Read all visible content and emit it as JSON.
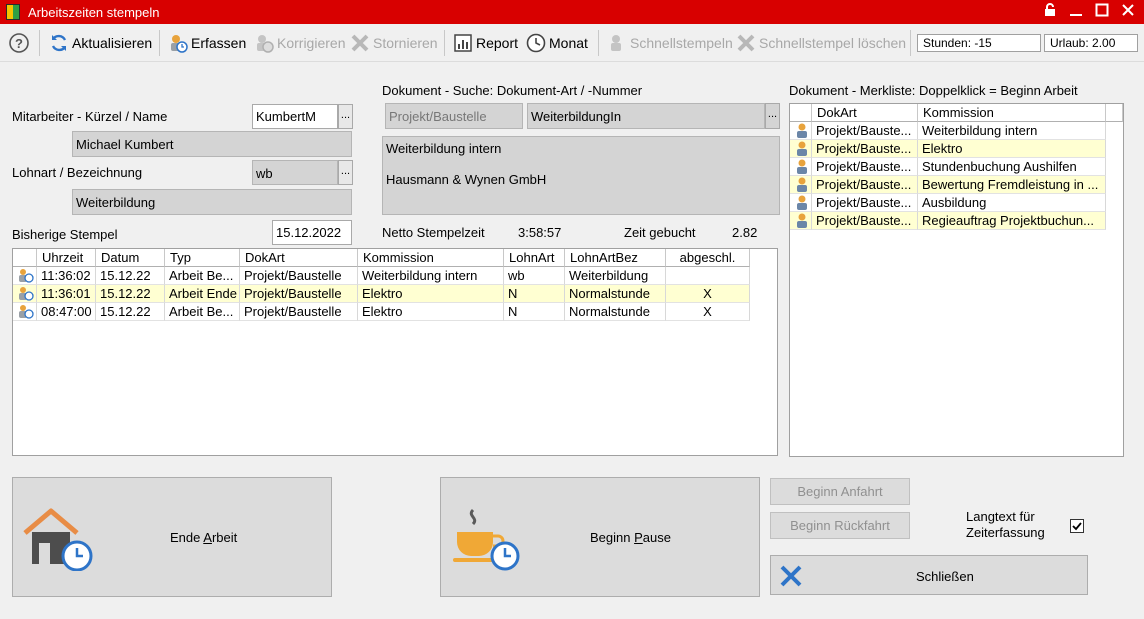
{
  "window": {
    "title": "Arbeitszeiten stempeln"
  },
  "toolbar": {
    "refresh_label": "Aktualisieren",
    "capture_label": "Erfassen",
    "correct_label": "Korrigieren",
    "cancel_label": "Stornieren",
    "report_label": "Report",
    "month_label": "Monat",
    "quickstamp_label": "Schnellstempeln",
    "quickstamp_delete_label": "Schnellstempel löschen",
    "hours": "Stunden: -15",
    "vacation": "Urlaub:  2.00"
  },
  "employee": {
    "label": "Mitarbeiter - Kürzel / Name",
    "code": "KumbertM",
    "name": "Michael Kumbert"
  },
  "wage": {
    "label": "Lohnart / Bezeichnung",
    "code": "wb",
    "name": "Weiterbildung"
  },
  "stamps": {
    "label": "Bisherige Stempel",
    "date": "15.12.2022",
    "columns": [
      "Uhrzeit",
      "Datum",
      "Typ",
      "DokArt",
      "Kommission",
      "LohnArt",
      "LohnArtBez",
      "abgeschl."
    ],
    "rows": [
      [
        "11:36:02",
        "15.12.22",
        "Arbeit Be...",
        "Projekt/Baustelle",
        "Weiterbildung intern",
        "wb",
        "Weiterbildung",
        ""
      ],
      [
        "11:36:01",
        "15.12.22",
        "Arbeit Ende",
        "Projekt/Baustelle",
        "Elektro",
        "N",
        "Normalstunde",
        "X"
      ],
      [
        "08:47:00",
        "15.12.22",
        "Arbeit Be...",
        "Projekt/Baustelle",
        "Elektro",
        "N",
        "Normalstunde",
        "X"
      ]
    ]
  },
  "doc_search": {
    "label": "Dokument - Suche: Dokument-Art / -Nummer",
    "type": "Projekt/Baustelle",
    "number": "WeiterbildungIn",
    "desc_line1": "Weiterbildung intern",
    "desc_line2": "Hausmann & Wynen GmbH",
    "net_label": "Netto Stempelzeit",
    "net_value": "3:58:57",
    "booked_label": "Zeit gebucht",
    "booked_value": "2.82"
  },
  "watchlist": {
    "label": "Dokument - Merkliste: Doppelklick = Beginn Arbeit",
    "columns": [
      "DokArt",
      "Kommission"
    ],
    "rows": [
      [
        "Projekt/Bauste...",
        "Weiterbildung intern"
      ],
      [
        "Projekt/Bauste...",
        "Elektro"
      ],
      [
        "Projekt/Bauste...",
        "Stundenbuchung Aushilfen"
      ],
      [
        "Projekt/Bauste...",
        "Bewertung Fremdleistung in ..."
      ],
      [
        "Projekt/Bauste...",
        "Ausbildung"
      ],
      [
        "Projekt/Bauste...",
        "Regieauftrag  Projektbuchun..."
      ]
    ]
  },
  "actions": {
    "end_work_pre": "Ende ",
    "end_work_acc": "A",
    "end_work_post": "rbeit",
    "pause_pre": "Beginn ",
    "pause_acc": "P",
    "pause_post": "ause",
    "start_trip": "Beginn Anfahrt",
    "return_trip": "Beginn Rückfahrt",
    "longtext_label": "Langtext für Zeiterfassung",
    "close_label": "Schließen"
  },
  "colors": {
    "titlebar": "#d80000",
    "highlight_row": "#ffffd2",
    "close_x": "#2e74c8"
  }
}
